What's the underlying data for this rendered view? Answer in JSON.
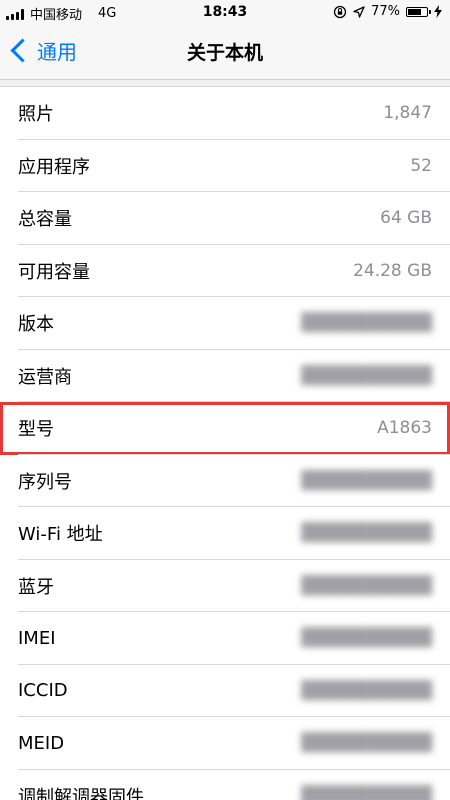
{
  "status_bar": {
    "carrier": "中国移动",
    "network": "4G",
    "time": "18:43",
    "battery_percent": "77%",
    "battery_level": 0.77,
    "icons": [
      "signal-icon",
      "orientation-lock-icon",
      "location-icon",
      "battery-icon",
      "charging-icon"
    ]
  },
  "nav": {
    "back_label": "通用",
    "title": "关于本机"
  },
  "rows": [
    {
      "label": "照片",
      "value": "1,847",
      "obscured": false
    },
    {
      "label": "应用程序",
      "value": "52",
      "obscured": false
    },
    {
      "label": "总容量",
      "value": "64 GB",
      "obscured": false
    },
    {
      "label": "可用容量",
      "value": "24.28 GB",
      "obscured": false
    },
    {
      "label": "版本",
      "value": "",
      "obscured": true
    },
    {
      "label": "运营商",
      "value": "",
      "obscured": true
    },
    {
      "label": "型号",
      "value": "A1863",
      "obscured": false,
      "highlighted": true
    },
    {
      "label": "序列号",
      "value": "",
      "obscured": true
    },
    {
      "label": "Wi-Fi 地址",
      "value": "",
      "obscured": true
    },
    {
      "label": "蓝牙",
      "value": "",
      "obscured": true
    },
    {
      "label": "IMEI",
      "value": "",
      "obscured": true
    },
    {
      "label": "ICCID",
      "value": "",
      "obscured": true
    },
    {
      "label": "MEID",
      "value": "",
      "obscured": true
    },
    {
      "label": "调制解调器固件",
      "value": "",
      "obscured": true
    }
  ],
  "colors": {
    "accent": "#007aff",
    "highlight_border": "#e53935",
    "value_text": "#8e8e93"
  }
}
